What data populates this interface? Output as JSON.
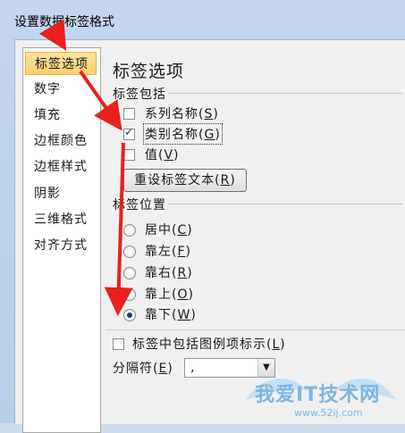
{
  "window": {
    "title": "设置数据标签格式"
  },
  "nav": {
    "items": [
      {
        "label": "标签选项",
        "selected": true
      },
      {
        "label": "数字"
      },
      {
        "label": "填充"
      },
      {
        "label": "边框颜色"
      },
      {
        "label": "边框样式"
      },
      {
        "label": "阴影"
      },
      {
        "label": "三维格式"
      },
      {
        "label": "对齐方式"
      }
    ]
  },
  "panel": {
    "title": "标签选项",
    "contains": {
      "label": "标签包括",
      "series_name": {
        "text": "系列名称(",
        "key": "S",
        "end": ")",
        "checked": false
      },
      "category_name": {
        "text": "类别名称(",
        "key": "G",
        "end": ")",
        "checked": true
      },
      "value": {
        "text": "值(",
        "key": "V",
        "end": ")",
        "checked": false
      },
      "reset_button": {
        "text": "重设标签文本(",
        "key": "R",
        "end": ")"
      }
    },
    "position": {
      "label": "标签位置",
      "options": [
        {
          "text": "居中(",
          "key": "C",
          "end": ")",
          "selected": false
        },
        {
          "text": "靠左(",
          "key": "F",
          "end": ")",
          "selected": false
        },
        {
          "text": "靠右(",
          "key": "R",
          "end": ")",
          "selected": false
        },
        {
          "text": "靠上(",
          "key": "O",
          "end": ")",
          "selected": false
        },
        {
          "text": "靠下(",
          "key": "W",
          "end": ")",
          "selected": true
        }
      ]
    },
    "legend_key": {
      "text": "标签中包括图例项标示(",
      "key": "L",
      "end": ")",
      "checked": false
    },
    "separator": {
      "label": "分隔符(",
      "key": "E",
      "end": ")",
      "value": ","
    }
  },
  "watermark": {
    "text": "我爱IT技术网",
    "url": "www.52ij.com"
  },
  "colors": {
    "selected_nav": "#ffce6b",
    "arrow": "#e8201e",
    "title_bar": "#c4d6ee"
  }
}
